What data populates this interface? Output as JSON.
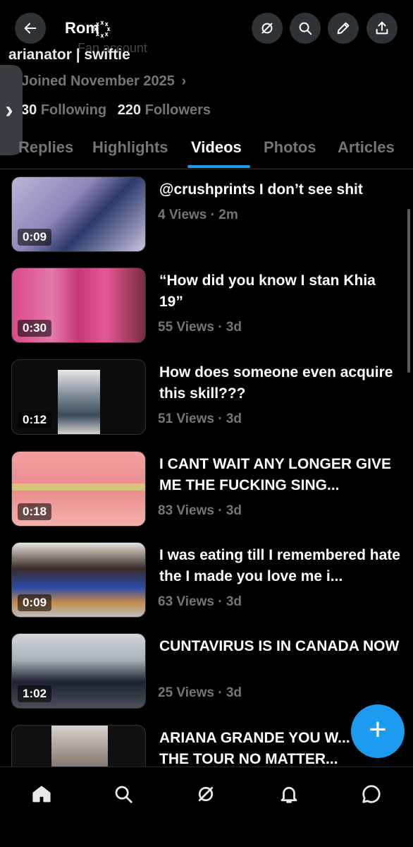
{
  "header": {
    "name": "Rom",
    "name_badge": "꙰",
    "peek_text": "Fan account",
    "buttons": [
      "back-icon",
      "grok-icon",
      "search-icon",
      "edit-icon",
      "share-icon"
    ]
  },
  "profile": {
    "bio": "arianator | swiftie",
    "joined": "Joined November 2025",
    "following_count": "30",
    "following_label": "Following",
    "followers_count": "220",
    "followers_label": "Followers"
  },
  "tabs": [
    {
      "label": "Replies"
    },
    {
      "label": "Highlights"
    },
    {
      "label": "Videos",
      "active": true
    },
    {
      "label": "Photos"
    },
    {
      "label": "Articles"
    }
  ],
  "videos": [
    {
      "duration": "0:09",
      "title": "@crushprints I don’t see shit",
      "meta": "4 Views · 2m"
    },
    {
      "duration": "0:30",
      "title": "“How did you know I stan Khia 19”",
      "meta": "55 Views · 3d"
    },
    {
      "duration": "0:12",
      "title": "How does someone even acquire this skill???",
      "meta": "51 Views · 3d"
    },
    {
      "duration": "0:18",
      "title": "I CANT WAIT ANY LONGER GIVE ME THE FUCKING SING...",
      "meta": "83 Views · 3d"
    },
    {
      "duration": "0:09",
      "title": "I was eating till I remembered hate the I made you love me i...",
      "meta": "63 Views · 3d"
    },
    {
      "duration": "1:02",
      "title": "CUNTAVIRUS IS IN CANADA NOW",
      "meta": "25 Views · 3d"
    },
    {
      "duration": "",
      "title": "ARIANA GRANDE YOU W... DO THE TOUR NO MATTER...",
      "meta": ""
    }
  ],
  "fab": {
    "icon": "plus-icon",
    "label": "+"
  },
  "bottom_nav": [
    "home-icon",
    "search-icon",
    "grok-icon",
    "notifications-icon",
    "messages-icon"
  ],
  "colors": {
    "accent": "#1d9bf0",
    "background": "#000000",
    "muted": "#71767b"
  }
}
